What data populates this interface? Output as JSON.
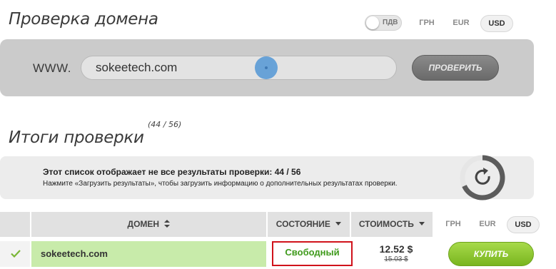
{
  "header": {
    "title": "Проверка домена",
    "vat_toggle_label": "ПДВ",
    "currencies": [
      "ГРН",
      "EUR",
      "USD"
    ],
    "active_currency": "USD"
  },
  "search": {
    "prefix": "WWW.",
    "domain_value": "sokeetech.com",
    "check_button": "ПРОВЕРИТЬ"
  },
  "results": {
    "title": "Итоги проверки",
    "count": "(44 / 56)",
    "notice_main": "Этот список отображает не все результаты проверки: 44 / 56",
    "notice_sub": "Нажмите «Загрузить результаты», чтобы загрузить информацию о дополнительных результатах проверки.",
    "loader_icon": "refresh-icon"
  },
  "table": {
    "headers": {
      "domain": "ДОМЕН",
      "status": "СОСТОЯНИЕ",
      "price": "СТОИМОСТЬ"
    },
    "currencies": [
      "ГРН",
      "EUR",
      "USD"
    ],
    "active_currency": "USD",
    "rows": [
      {
        "domain": "sokeetech.com",
        "status": "Свободный",
        "price": "12.52 $",
        "old_price": "15.03 $",
        "buy_label": "КУПИТЬ"
      }
    ]
  },
  "colors": {
    "available_green": "#3f9a1c",
    "row_highlight": "#c8ebaa",
    "status_outline": "#d0121b",
    "buy_button": "#8cc63e"
  }
}
